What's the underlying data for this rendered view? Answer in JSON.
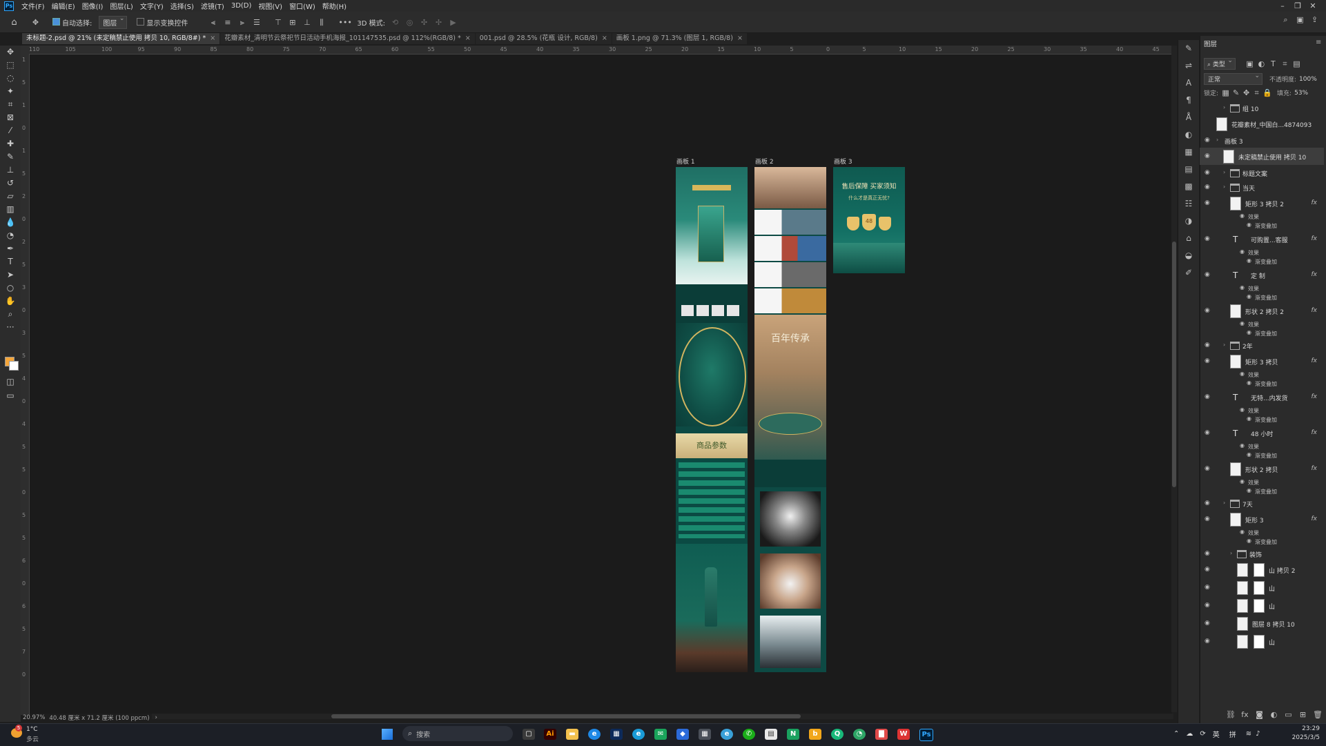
{
  "menubar": {
    "app_icon": "Ps",
    "items": [
      "文件(F)",
      "编辑(E)",
      "图像(I)",
      "图层(L)",
      "文字(Y)",
      "选择(S)",
      "滤镜(T)",
      "3D(D)",
      "视图(V)",
      "窗口(W)",
      "帮助(H)"
    ]
  },
  "options": {
    "auto_select_label": "自动选择:",
    "auto_select_target": "图层",
    "show_transform_label": "显示变换控件",
    "mode_3d_label": "3D 模式:"
  },
  "tabs": [
    {
      "label": "未标题-2.psd @ 21% (未定稿禁止使用 拷贝 10, RGB/8#) *",
      "active": true
    },
    {
      "label": "花瓣素材_清明节云祭祀节日活动手机海报_101147535.psd @ 112%(RGB/8) *",
      "active": false
    },
    {
      "label": "001.psd @ 28.5% (花瓶 设计, RGB/8)",
      "active": false
    },
    {
      "label": "画板 1.png @ 71.3% (图层 1, RGB/8)",
      "active": false
    }
  ],
  "ruler_h": [
    "110",
    "105",
    "100",
    "95",
    "90",
    "85",
    "80",
    "75",
    "70",
    "65",
    "60",
    "55",
    "50",
    "45",
    "40",
    "35",
    "30",
    "25",
    "20",
    "15",
    "10",
    "5",
    "0",
    "5",
    "10",
    "15",
    "20",
    "25",
    "30",
    "35",
    "40",
    "45"
  ],
  "ruler_v": [
    "1",
    "5",
    "1",
    "0",
    "1",
    "5",
    "2",
    "0",
    "2",
    "5",
    "3",
    "0",
    "3",
    "5",
    "4",
    "0",
    "4",
    "5",
    "5",
    "0",
    "5",
    "5",
    "6",
    "0",
    "6",
    "5",
    "7",
    "0"
  ],
  "artboards": [
    {
      "label": "画板 1"
    },
    {
      "label": "画板 2"
    },
    {
      "label": "画板 3"
    }
  ],
  "artboard_text": {
    "ab1_params": "商品参数",
    "ab2_title": "百年传承",
    "ab3_title": "售后保障 买家须知",
    "ab3_sub": "什么才是真正无忧?",
    "ab3_badge": "48"
  },
  "status": {
    "zoom": "20.97%",
    "doc_size": "40.48 厘米 x 71.2 厘米 (100 ppcm)"
  },
  "layers_panel": {
    "title": "图层",
    "filter_label": "类型",
    "blend_mode": "正常",
    "opacity_label": "不透明度:",
    "opacity_value": "100%",
    "lock_label": "锁定:",
    "fill_label": "填充:",
    "fill_value": "53%",
    "layers": [
      {
        "name": "组 10",
        "kind": "group",
        "visible": false,
        "indent": 1
      },
      {
        "name": "花瓣素材_中国白...4874093",
        "kind": "image",
        "visible": false,
        "indent": 0
      },
      {
        "name": "画板 3",
        "kind": "artboard",
        "visible": true,
        "indent": 0
      },
      {
        "name": "未定稿禁止使用 拷贝 10",
        "kind": "image",
        "visible": true,
        "indent": 1,
        "selected": true
      },
      {
        "name": "标题文案",
        "kind": "group",
        "visible": true,
        "indent": 1
      },
      {
        "name": "当天",
        "kind": "group",
        "visible": true,
        "indent": 1
      },
      {
        "name": "矩形 3 拷贝 2",
        "kind": "shape",
        "visible": true,
        "indent": 2,
        "fx": true
      },
      {
        "name": "效果",
        "kind": "effect",
        "visible": true,
        "indent": 3
      },
      {
        "name": "渐变叠加",
        "kind": "effect",
        "visible": true,
        "indent": 4
      },
      {
        "name": "可购置...客服",
        "kind": "text",
        "visible": true,
        "indent": 2,
        "fx": true
      },
      {
        "name": "效果",
        "kind": "effect",
        "visible": true,
        "indent": 3
      },
      {
        "name": "渐变叠加",
        "kind": "effect",
        "visible": true,
        "indent": 4
      },
      {
        "name": "定 制",
        "kind": "text",
        "visible": true,
        "indent": 2,
        "fx": true
      },
      {
        "name": "效果",
        "kind": "effect",
        "visible": true,
        "indent": 3
      },
      {
        "name": "渐变叠加",
        "kind": "effect",
        "visible": true,
        "indent": 4
      },
      {
        "name": "形状 2 拷贝 2",
        "kind": "shape",
        "visible": true,
        "indent": 2,
        "fx": true
      },
      {
        "name": "效果",
        "kind": "effect",
        "visible": true,
        "indent": 3
      },
      {
        "name": "渐变叠加",
        "kind": "effect",
        "visible": true,
        "indent": 4
      },
      {
        "name": "2年",
        "kind": "group",
        "visible": true,
        "indent": 1
      },
      {
        "name": "矩形 3 拷贝",
        "kind": "shape",
        "visible": true,
        "indent": 2,
        "fx": true
      },
      {
        "name": "效果",
        "kind": "effect",
        "visible": true,
        "indent": 3
      },
      {
        "name": "渐变叠加",
        "kind": "effect",
        "visible": true,
        "indent": 4
      },
      {
        "name": "无特...内发货",
        "kind": "text",
        "visible": true,
        "indent": 2,
        "fx": true
      },
      {
        "name": "效果",
        "kind": "effect",
        "visible": true,
        "indent": 3
      },
      {
        "name": "渐变叠加",
        "kind": "effect",
        "visible": true,
        "indent": 4
      },
      {
        "name": "48 小时",
        "kind": "text",
        "visible": true,
        "indent": 2,
        "fx": true
      },
      {
        "name": "效果",
        "kind": "effect",
        "visible": true,
        "indent": 3
      },
      {
        "name": "渐变叠加",
        "kind": "effect",
        "visible": true,
        "indent": 4
      },
      {
        "name": "形状 2 拷贝",
        "kind": "shape",
        "visible": true,
        "indent": 2,
        "fx": true
      },
      {
        "name": "效果",
        "kind": "effect",
        "visible": true,
        "indent": 3
      },
      {
        "name": "渐变叠加",
        "kind": "effect",
        "visible": true,
        "indent": 4
      },
      {
        "name": "7天",
        "kind": "group",
        "visible": true,
        "indent": 1
      },
      {
        "name": "矩形 3",
        "kind": "shape",
        "visible": true,
        "indent": 2,
        "fx": true
      },
      {
        "name": "效果",
        "kind": "effect",
        "visible": true,
        "indent": 3
      },
      {
        "name": "渐变叠加",
        "kind": "effect",
        "visible": true,
        "indent": 4
      },
      {
        "name": "装饰",
        "kind": "group",
        "visible": true,
        "indent": 2
      },
      {
        "name": "山 拷贝 2",
        "kind": "masked",
        "visible": true,
        "indent": 3
      },
      {
        "name": "山",
        "kind": "masked",
        "visible": true,
        "indent": 3
      },
      {
        "name": "山",
        "kind": "masked",
        "visible": true,
        "indent": 3
      },
      {
        "name": "图层 8 拷贝 10",
        "kind": "image",
        "visible": true,
        "indent": 3
      },
      {
        "name": "山",
        "kind": "masked",
        "visible": true,
        "indent": 3
      }
    ]
  },
  "taskbar": {
    "weather_temp": "1°C",
    "weather_desc": "多云",
    "weather_badge": "5",
    "search_placeholder": "搜索",
    "apps": [
      "edge",
      "files",
      "ai",
      "explorer",
      "edge-dev",
      "store",
      "edge-beta",
      "mail",
      "defender",
      "calculator",
      "edge-can",
      "wechat",
      "notepad",
      "app-green",
      "app-orange",
      "app-teal",
      "app-green2",
      "app-red",
      "wps",
      "photoshop"
    ],
    "ime_1": "英",
    "ime_2": "拼",
    "time": "23:29",
    "date": "2025/3/5"
  },
  "colors": {
    "accent_ps": "#31a8ff",
    "foreground_swatch": "#f5a63a",
    "background_swatch": "#ffffff",
    "teal_design": "#0e5a52"
  }
}
